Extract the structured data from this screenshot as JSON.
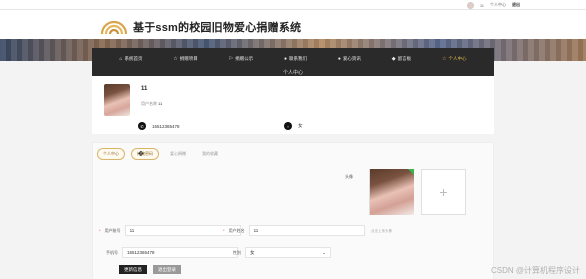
{
  "topbar": {
    "username": "11",
    "user_center": "个人中心",
    "logout": "退出"
  },
  "header": {
    "title": "基于ssm的校园旧物爱心捐赠系统"
  },
  "nav": [
    {
      "icon": "home-icon",
      "glyph": "⌂",
      "label": "系统首页"
    },
    {
      "icon": "star-icon",
      "glyph": "☆",
      "label": "捐赠项目"
    },
    {
      "icon": "bag-icon",
      "glyph": "⚐",
      "label": "捐赠公示"
    },
    {
      "icon": "info-icon",
      "glyph": "●",
      "label": "联系我们"
    },
    {
      "icon": "heart-icon",
      "glyph": "●",
      "label": "爱心资讯"
    },
    {
      "icon": "feedback-icon",
      "glyph": "◆",
      "label": "留言板"
    },
    {
      "icon": "user-icon",
      "glyph": "☆",
      "label": "个人中心",
      "active": true
    }
  ],
  "profile": {
    "page_heading": "个人中心",
    "name": "11",
    "user_label": "用户名称",
    "user_value": "11",
    "phone": "15512365478",
    "gender": "女"
  },
  "tabs": [
    {
      "label": "个人中心",
      "active": true
    },
    {
      "label": "修改密码",
      "active": true
    },
    {
      "label": "爱心捐赠",
      "active": false
    },
    {
      "label": "我的收藏",
      "active": false
    }
  ],
  "form": {
    "account_label": "用户账号",
    "account_value": "11",
    "name_label": "用户姓名",
    "name_value": "11",
    "phone_label": "手机号",
    "phone_value": "15512365478",
    "gender_label": "性别",
    "gender_value": "女",
    "avatar_label": "头像",
    "upload_hint": "点击上传头像",
    "update_btn": "更新信息",
    "logout_btn": "退出登录"
  },
  "watermark": "CSDN @计算机程序设计"
}
